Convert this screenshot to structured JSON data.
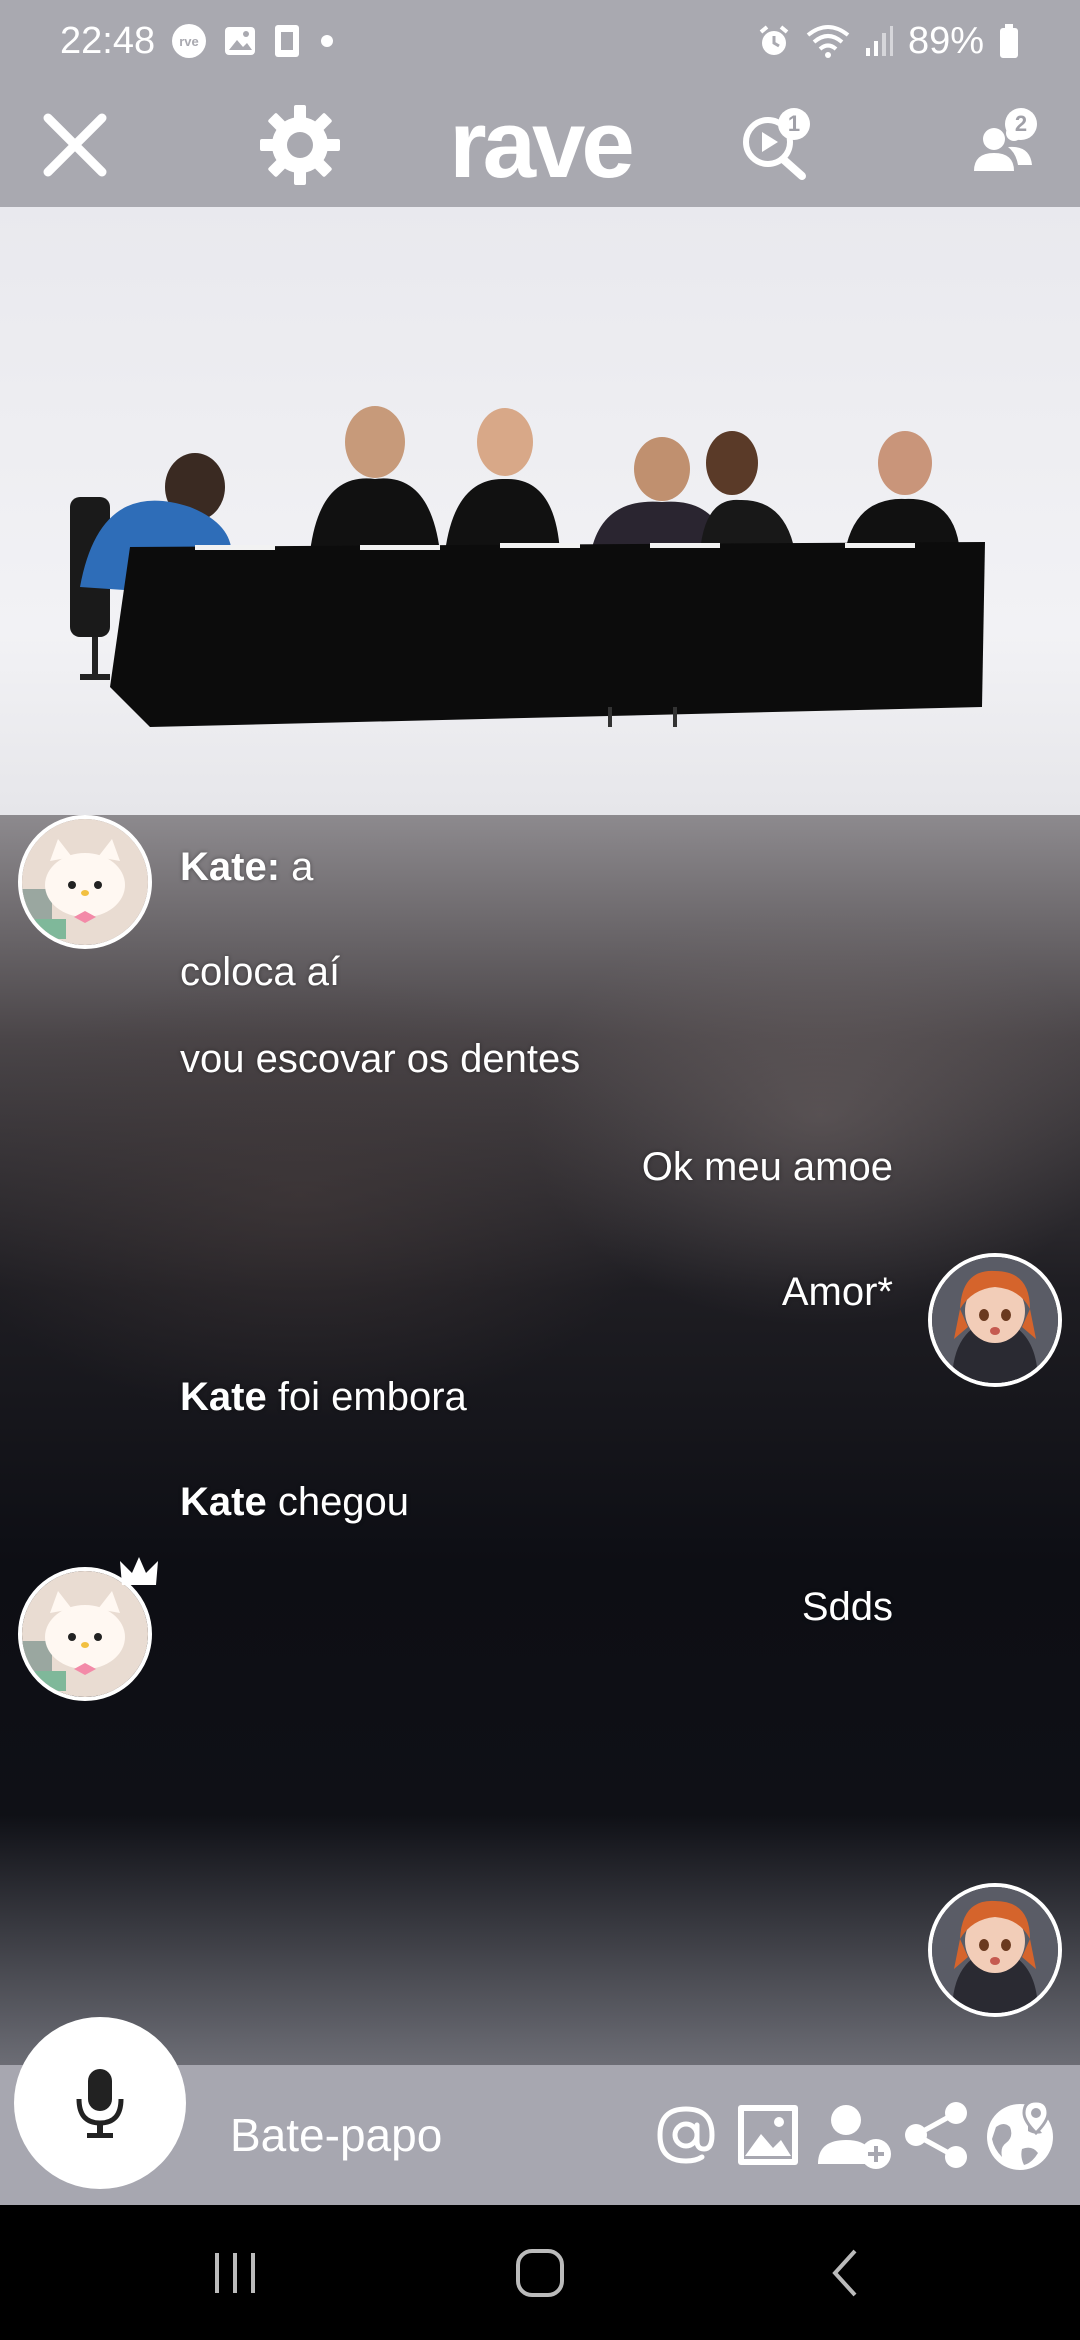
{
  "status_bar": {
    "time": "22:48",
    "battery": "89%"
  },
  "top_bar": {
    "logo": "rave",
    "queue_badge": "1",
    "users_badge": "2"
  },
  "chat": {
    "messages": [
      {
        "user": "Kate",
        "text": " a"
      },
      {
        "text": "coloca aí"
      },
      {
        "text": "vou escovar os dentes"
      },
      {
        "text": "Ok meu amoe"
      },
      {
        "text": "Amor*"
      },
      {
        "user": "Kate",
        "text": " foi embora"
      },
      {
        "user": "Kate",
        "text": " chegou"
      },
      {
        "text": "Sdds"
      }
    ],
    "kate_colon": ":"
  },
  "input_bar": {
    "chat_label": "Bate-papo"
  },
  "icons": {
    "close": "close-icon",
    "settings": "gear-icon",
    "queue": "queue-search-icon",
    "users": "users-icon",
    "mic": "microphone-icon",
    "mention": "at-icon",
    "image": "image-icon",
    "add_user": "add-user-icon",
    "share": "share-icon",
    "globe": "globe-location-icon"
  },
  "colors": {
    "bar": "#a9a9b0",
    "text": "#ffffff"
  }
}
